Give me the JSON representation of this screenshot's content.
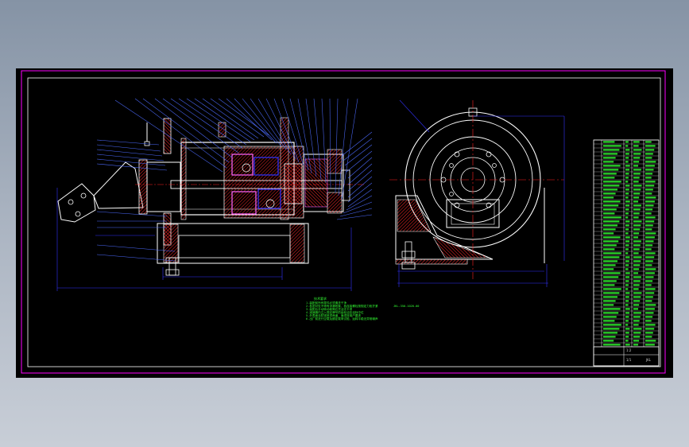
{
  "viewer": {
    "background_gradient": [
      "#8593a5",
      "#c8ced7"
    ],
    "canvas_color": "#000000"
  },
  "colors": {
    "frame": "#ff00ff",
    "outline": "#ffffff",
    "dimension": "#3333ff",
    "leader": "#4d6bff",
    "hatch": "#ff2a2a",
    "centerline": "#ff2020",
    "notes": "#33ff33",
    "highlight": "#ff66ff"
  },
  "notes": {
    "heading": "技术要求",
    "lines": [
      "1.装配前所有零件必须清洗干净",
      "2.各密封处不得有渗漏现象，各连接螺栓按规定力矩拧紧",
      "3.装配后手动转动卷筒应灵活无卡滞",
      "4.减速器内注入规定牌号的齿轮油至油标中位",
      "5.外表面涂防锈底漆两道，面漆按用户要求",
      "6.出厂前进行空载及额定载荷试验，运转平稳无异常噪声"
    ],
    "right_label": "JKL-350-1020-00"
  },
  "title_block": {
    "drawing_no": "JKL",
    "scale": "1:2",
    "sheet": "1/1"
  }
}
